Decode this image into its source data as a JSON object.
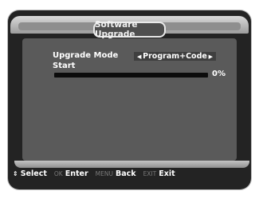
{
  "window": {
    "title": "Software Upgrade"
  },
  "form": {
    "upgrade_mode_label": "Upgrade Mode",
    "upgrade_mode_value": "Program+Code",
    "start_label": "Start",
    "progress_percent": 0,
    "progress_text": "0%"
  },
  "footer": {
    "select_action": "Select",
    "enter_key": "OK",
    "enter_action": "Enter",
    "back_key": "MENU",
    "back_action": "Back",
    "exit_key": "EXIT",
    "exit_action": "Exit"
  },
  "colors": {
    "screen_bg": "#232323",
    "panel_bg": "#5a5a5a",
    "text": "#ffffff"
  },
  "icons": {
    "left_arrow": "left-arrow-icon",
    "right_arrow": "right-arrow-icon",
    "updown": "up-down-icon"
  }
}
